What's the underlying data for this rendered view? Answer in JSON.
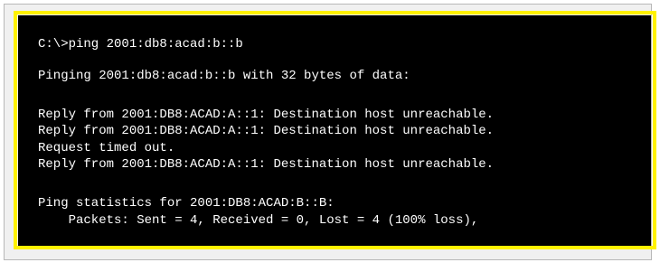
{
  "terminal": {
    "lines": [
      "C:\\>ping 2001:db8:acad:b::b",
      "Pinging 2001:db8:acad:b::b with 32 bytes of data:",
      "Reply from 2001:DB8:ACAD:A::1: Destination host unreachable.",
      "Reply from 2001:DB8:ACAD:A::1: Destination host unreachable.",
      "Request timed out.",
      "Reply from 2001:DB8:ACAD:A::1: Destination host unreachable.",
      "Ping statistics for 2001:DB8:ACAD:B::B:",
      "    Packets: Sent = 4, Received = 0, Lost = 4 (100% loss),"
    ]
  },
  "colors": {
    "background": "#000000",
    "text": "#ffffff",
    "highlight_border": "#fff200"
  }
}
